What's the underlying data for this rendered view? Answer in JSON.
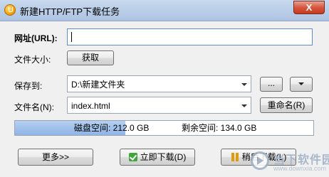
{
  "window": {
    "title": "新建HTTP/FTP下载任务",
    "close_symbol": "X",
    "icon": "download-app-icon"
  },
  "form": {
    "url_label": "网址(URL):",
    "url_value": "",
    "filesize_label": "文件大小:",
    "fetch_button": "获取",
    "saveto_label": "保存到:",
    "saveto_value": "D:\\新建文件夹",
    "browse_button": "...",
    "filename_label": "文件名(N):",
    "filename_value": "index.html",
    "rename_button": "重命名(R)"
  },
  "disk": {
    "space_text": "磁盘空间: 212.0 GB",
    "free_text": "剩余空间: 134.0 GB",
    "used_fraction": 0.37
  },
  "footer": {
    "more_button": "更多>>",
    "download_now_button": "立即下载(D)",
    "download_later_button": "稍后下载(L)"
  },
  "watermark": {
    "title": "当下软件园",
    "url": "www.downxia.com"
  }
}
